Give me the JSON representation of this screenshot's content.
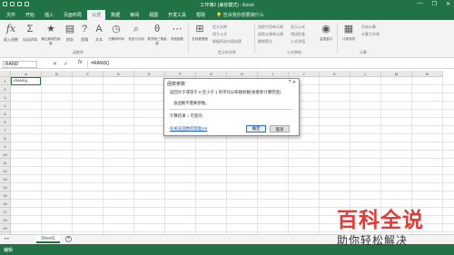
{
  "window": {
    "title": "工作簿2 (兼容模式) - Excel",
    "minimize": "—",
    "restore": "❐",
    "close": "✕"
  },
  "ribbon_tabs": [
    "文件",
    "开始",
    "插入",
    "页面布局",
    "公式",
    "数据",
    "审阅",
    "视图",
    "开发工具",
    "帮助"
  ],
  "tell_me": "告诉我你想要做什么",
  "ribbon": {
    "insert_function": "插入函数",
    "autosum": "自动求和",
    "recent": "最近使用的函数",
    "financial": "财务",
    "logical": "逻辑",
    "text": "文本",
    "datetime": "日期和时间",
    "lookup": "查找与引用",
    "math": "数学和三角函数",
    "other": "其他函数",
    "name_manager": "名称管理器",
    "define_name": "定义名称",
    "use_in_formula": "用于公式",
    "create_from_sel": "根据所选内容创建",
    "trace_precedents": "追踪引用单元格",
    "trace_dependents": "追踪从属单元格",
    "remove_arrows": "删除箭头",
    "show_formulas": "显示公式",
    "error_check": "错误检查",
    "evaluate": "公式求值",
    "watch": "监视窗口",
    "calc_options": "计算选项",
    "calc_now": "开始计算",
    "calc_sheet": "计算工作表",
    "group_library": "函数库",
    "group_names": "定义的名称",
    "group_audit": "公式审核",
    "group_calc": "计算"
  },
  "formula_bar": {
    "name_box": "RAND",
    "cancel": "✕",
    "enter": "✓",
    "fx": "fx",
    "content": "=RAND()"
  },
  "columns": [
    "A",
    "B",
    "C",
    "D",
    "E",
    "F",
    "G",
    "H",
    "I",
    "J",
    "K",
    "L",
    "M",
    "N"
  ],
  "rows": [
    "1",
    "2",
    "3",
    "4",
    "5",
    "6",
    "7",
    "8",
    "9",
    "10",
    "11",
    "12",
    "13",
    "14",
    "15",
    "16",
    "17",
    "18",
    "19",
    "20"
  ],
  "cell_a1": "=RAND()",
  "dialog": {
    "title": "函数参数",
    "close": "?  ✕",
    "description": "返回大于或等于 0 且小于 1 的平均分布随机数(依重新计算而变)",
    "no_args": "该函数不需要参数。",
    "result": "计算结果 =  可变的",
    "help_link": "有关该函数的帮助(H)",
    "ok": "确定",
    "cancel": "取消"
  },
  "sheets": {
    "active": "Sheet1",
    "add": "+",
    "nav": "◂ ▸"
  },
  "status": {
    "mode": "编辑"
  },
  "watermark": {
    "line1": "百科全说",
    "line2": "助你轻松解决"
  },
  "colors": {
    "excel_green": "#217346",
    "watermark_red": "#e53935"
  }
}
